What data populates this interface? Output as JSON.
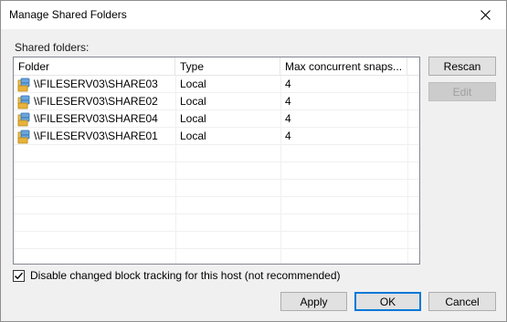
{
  "window": {
    "title": "Manage Shared Folders"
  },
  "shared_folders": {
    "label": "Shared folders:",
    "columns": [
      "Folder",
      "Type",
      "Max concurrent snaps..."
    ],
    "rows": [
      {
        "folder": "\\\\FILESERV03\\SHARE03",
        "type": "Local",
        "max": "4"
      },
      {
        "folder": "\\\\FILESERV03\\SHARE02",
        "type": "Local",
        "max": "4"
      },
      {
        "folder": "\\\\FILESERV03\\SHARE04",
        "type": "Local",
        "max": "4"
      },
      {
        "folder": "\\\\FILESERV03\\SHARE01",
        "type": "Local",
        "max": "4"
      }
    ]
  },
  "side_buttons": {
    "rescan": "Rescan",
    "edit": "Edit"
  },
  "option": {
    "checked": true,
    "label": "Disable changed block tracking for this host (not recommended)"
  },
  "footer": {
    "apply": "Apply",
    "ok": "OK",
    "cancel": "Cancel"
  },
  "icons": {
    "close": "close-icon",
    "row": "shared-folder-icon",
    "checkmark": "checkmark-icon"
  }
}
